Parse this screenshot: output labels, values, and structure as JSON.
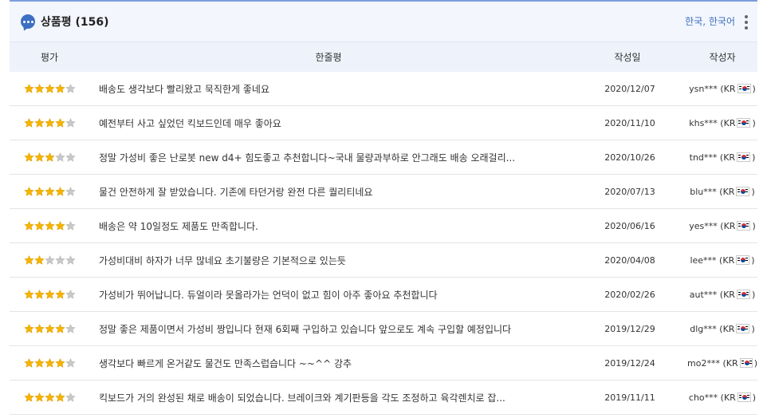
{
  "header": {
    "title": "상품평 (156)",
    "language_selector": "한국, 한국어"
  },
  "columns": {
    "rating": "평가",
    "review": "한줄평",
    "date": "작성일",
    "author": "작성자"
  },
  "reviews": [
    {
      "rating": 4,
      "text": "배송도 생각보다 빨리왔고 묵직한게 좋네요",
      "date": "2020/12/07",
      "user": "ysn***",
      "country": "KR"
    },
    {
      "rating": 4,
      "text": "예전부터 사고 싶었던 킥보드인데 매우 좋아요",
      "date": "2020/11/10",
      "user": "khs***",
      "country": "KR"
    },
    {
      "rating": 3,
      "text": "정말 가성비 좋은 난로봇 new d4+ 힘도좋고 추천합니다~국내 물량과부하로 안그래도 배송 오래걸리...",
      "date": "2020/10/26",
      "user": "tnd***",
      "country": "KR"
    },
    {
      "rating": 4,
      "text": "물건 안전하게 잘 받았습니다. 기존에 타던거랑 완전 다른 퀄리티네요",
      "date": "2020/07/13",
      "user": "blu***",
      "country": "KR"
    },
    {
      "rating": 4,
      "text": "배송은 약 10일정도 제품도 만족합니다.",
      "date": "2020/06/16",
      "user": "yes***",
      "country": "KR"
    },
    {
      "rating": 2,
      "text": "가성비대비 하자가 너무 많네요 초기불량은 기본적으로 있는듯",
      "date": "2020/04/08",
      "user": "lee***",
      "country": "KR"
    },
    {
      "rating": 4,
      "text": "가성비가 뛰어납니다. 듀얼이라 못올라가는 언덕이 없고 힘이 아주 좋아요 추천합니다",
      "date": "2020/02/26",
      "user": "aut***",
      "country": "KR"
    },
    {
      "rating": 4,
      "text": "정말 좋은 제품이면서 가성비 짱입니다 현재 6회째 구입하고 있습니다 앞으로도 계속 구입할 예정입니다",
      "date": "2019/12/29",
      "user": "dlg***",
      "country": "KR"
    },
    {
      "rating": 4,
      "text": "생각보다 빠르게 온거같도 물건도 만족스럽습니다 ~~^^ 강추",
      "date": "2019/12/24",
      "user": "mo2***",
      "country": "KR"
    },
    {
      "rating": 4,
      "text": "킥보드가 거의 완성된 채로 배송이 되었습니다. 브레이크와 계기판등을 각도 조정하고 육각렌치로 잡...",
      "date": "2019/11/11",
      "user": "cho***",
      "country": "KR"
    }
  ],
  "colors": {
    "accent": "#3d6fc2",
    "star_filled": "#f5b400",
    "star_empty": "#c8c8c8",
    "header_bg": "#edf2fb"
  },
  "icons": {
    "header": "chat-bubble-icon",
    "menu": "kebab-menu-icon",
    "flag": "korea-flag-icon",
    "rating": "star-icon"
  }
}
